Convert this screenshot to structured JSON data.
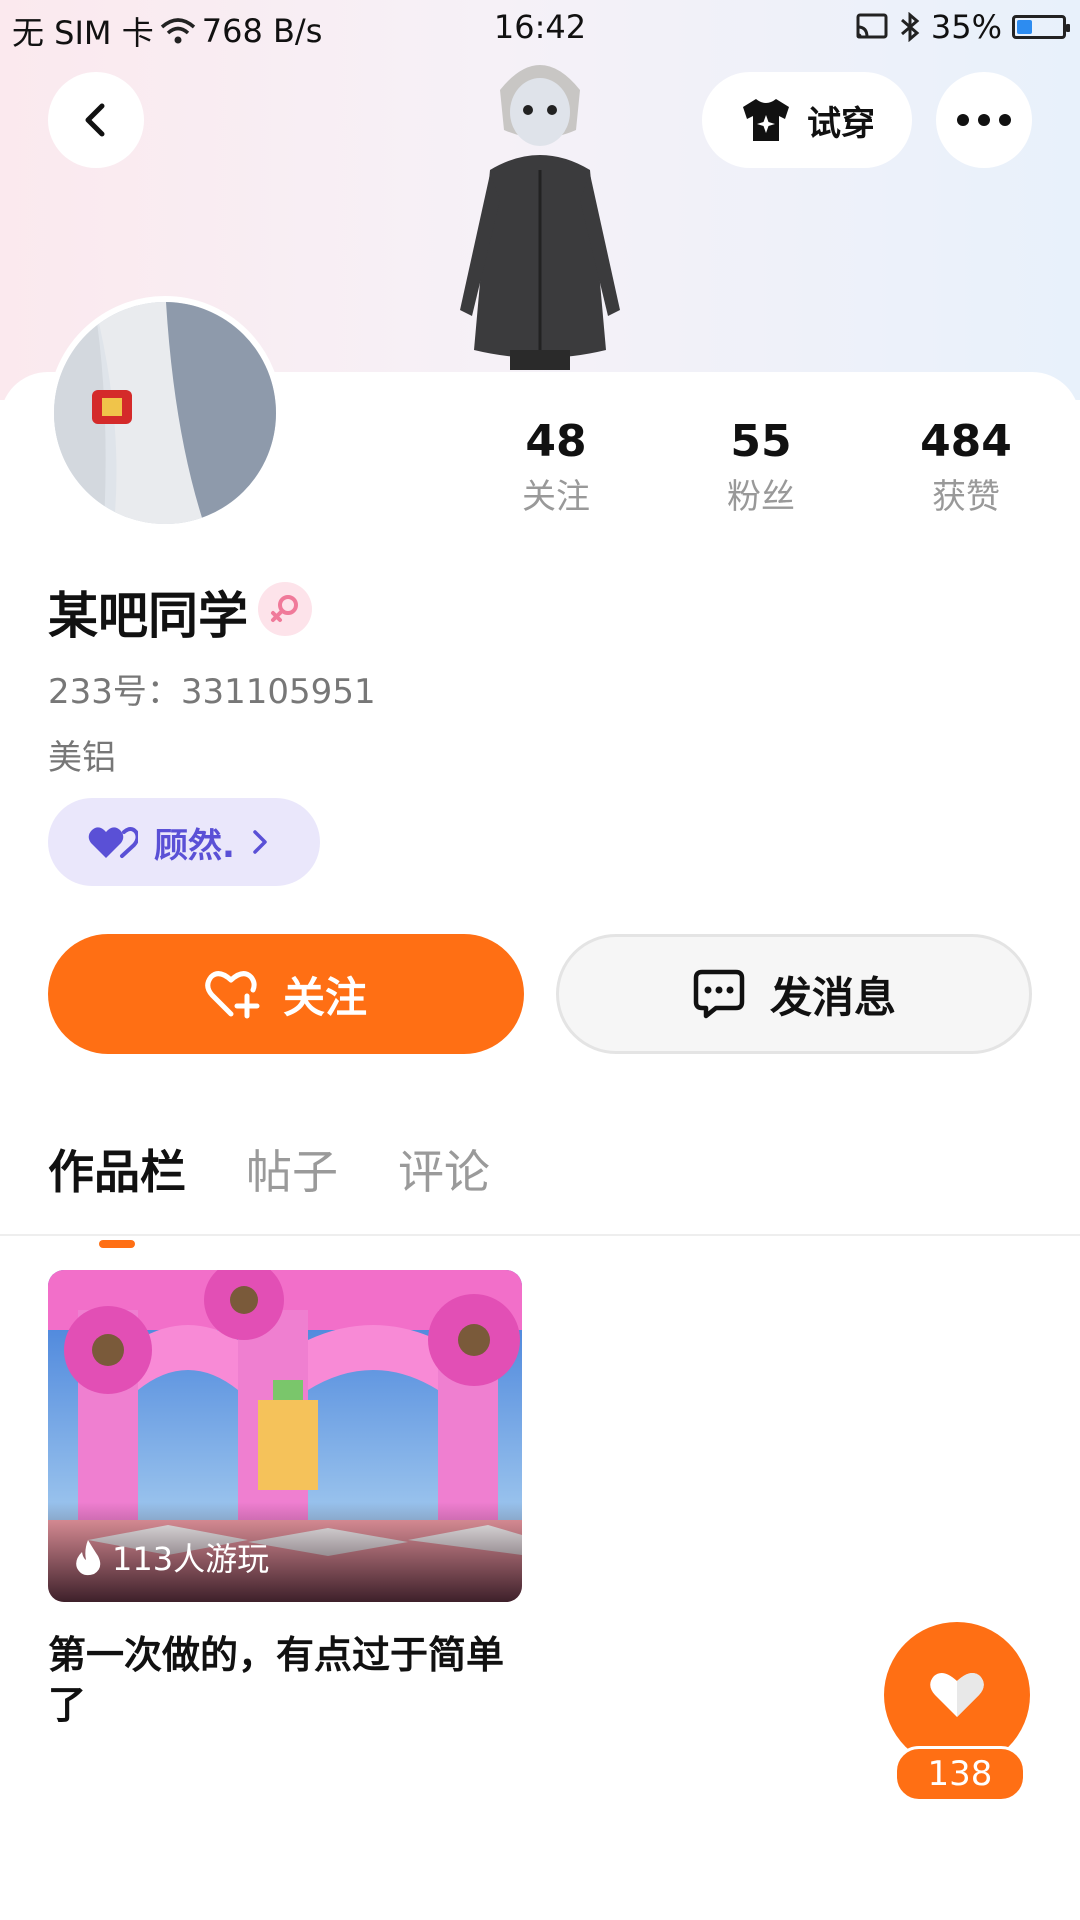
{
  "status_bar": {
    "sim": "无 SIM 卡",
    "net_speed": "768 B/s",
    "time": "16:42",
    "battery_pct": "35%",
    "battery_level": 0.35
  },
  "header": {
    "back_icon": "chevron-left-icon",
    "tryon_label": "试穿",
    "tryon_icon": "tshirt-icon",
    "more_icon": "more-horizontal-icon"
  },
  "profile": {
    "name": "某吧同学",
    "gender_icon": "female-icon",
    "id_text": "233号：331105951",
    "location": "美铝",
    "tag_label": "顾然.",
    "tag_icon": "double-heart-icon"
  },
  "stats": [
    {
      "value": "48",
      "label": "关注"
    },
    {
      "value": "55",
      "label": "粉丝"
    },
    {
      "value": "484",
      "label": "获赞"
    }
  ],
  "actions": {
    "follow_label": "关注",
    "follow_icon": "heart-plus-icon",
    "message_label": "发消息",
    "message_icon": "chat-bubble-icon"
  },
  "tabs": [
    {
      "label": "作品栏",
      "active": true
    },
    {
      "label": "帖子",
      "active": false
    },
    {
      "label": "评论",
      "active": false
    }
  ],
  "works": [
    {
      "plays": "113人游玩",
      "title": "第一次做的，有点过于简单了"
    }
  ],
  "fab": {
    "like_icon": "heart-icon",
    "count": "138"
  },
  "colors": {
    "accent": "#ff6f14",
    "tag_bg": "#eae7fb",
    "tag_text": "#5a50d6"
  }
}
